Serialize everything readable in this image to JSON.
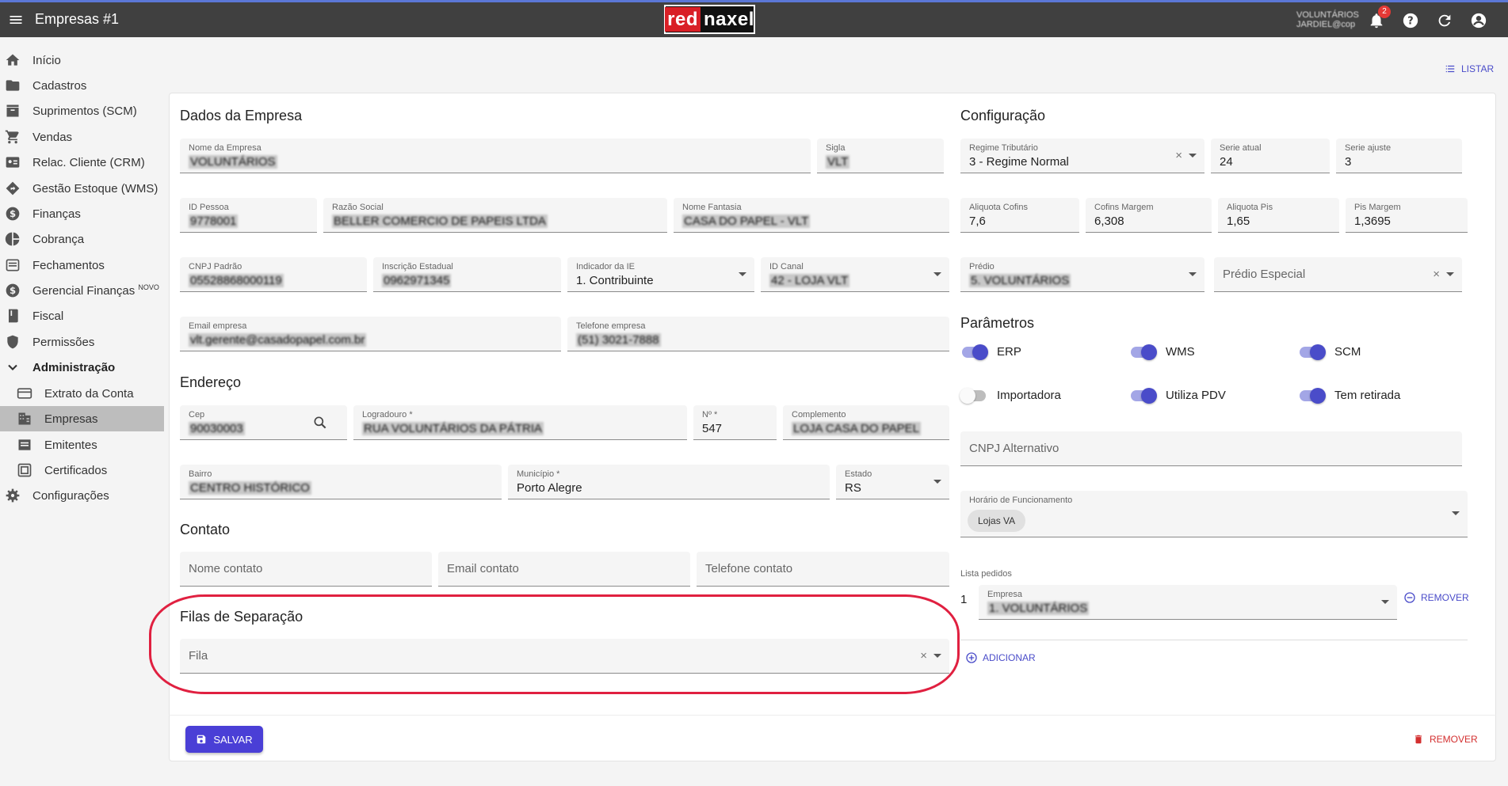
{
  "header": {
    "title": "Empresas #1",
    "logo_left": "red",
    "logo_right": "naxel",
    "user_line1": "VOLUNTÁRIOS",
    "user_line2": "JARDIEL@cop",
    "notifications": "2"
  },
  "sidebar": {
    "items": [
      {
        "label": "Início"
      },
      {
        "label": "Cadastros"
      },
      {
        "label": "Suprimentos (SCM)"
      },
      {
        "label": "Vendas"
      },
      {
        "label": "Relac. Cliente (CRM)"
      },
      {
        "label": "Gestão Estoque (WMS)"
      },
      {
        "label": "Finanças"
      },
      {
        "label": "Cobrança"
      },
      {
        "label": "Fechamentos"
      },
      {
        "label": "Gerencial Finanças",
        "badge": "NOVO"
      },
      {
        "label": "Fiscal"
      },
      {
        "label": "Permissões"
      },
      {
        "label": "Administração"
      },
      {
        "label": "Extrato da Conta"
      },
      {
        "label": "Empresas"
      },
      {
        "label": "Emitentes"
      },
      {
        "label": "Certificados"
      },
      {
        "label": "Configurações"
      }
    ]
  },
  "listar_label": "LISTAR",
  "dados": {
    "title": "Dados da Empresa",
    "nome_empresa": {
      "label": "Nome da Empresa",
      "value": "VOLUNTÁRIOS"
    },
    "sigla": {
      "label": "Sigla",
      "value": "VLT"
    },
    "id_pessoa": {
      "label": "ID Pessoa",
      "value": "9778001"
    },
    "razao_social": {
      "label": "Razão Social",
      "value": "BELLER COMERCIO DE PAPEIS LTDA"
    },
    "nome_fantasia": {
      "label": "Nome Fantasia",
      "value": "CASA DO PAPEL - VLT"
    },
    "cnpj": {
      "label": "CNPJ Padrão",
      "value": "05528868000119"
    },
    "inscricao": {
      "label": "Inscrição Estadual",
      "value": "0962971345"
    },
    "indicador_ie": {
      "label": "Indicador da IE",
      "value": "1. Contribuinte"
    },
    "id_canal": {
      "label": "ID Canal",
      "value": "42 - LOJA VLT"
    },
    "email": {
      "label": "Email empresa",
      "value": "vlt.gerente@casadopapel.com.br"
    },
    "telefone": {
      "label": "Telefone empresa",
      "value": "(51) 3021-7888"
    }
  },
  "endereco": {
    "title": "Endereço",
    "cep": {
      "label": "Cep",
      "value": "90030003"
    },
    "logradouro": {
      "label": "Logradouro *",
      "value": "RUA VOLUNTÁRIOS DA PÁTRIA"
    },
    "numero": {
      "label": "Nº *",
      "value": "547"
    },
    "complemento": {
      "label": "Complemento",
      "value": "LOJA CASA DO PAPEL"
    },
    "bairro": {
      "label": "Bairro",
      "value": "CENTRO HISTÓRICO"
    },
    "municipio": {
      "label": "Município *",
      "value": "Porto Alegre"
    },
    "estado": {
      "label": "Estado",
      "value": "RS"
    }
  },
  "contato": {
    "title": "Contato",
    "nome_placeholder": "Nome contato",
    "email_placeholder": "Email contato",
    "telefone_placeholder": "Telefone contato"
  },
  "filas": {
    "title": "Filas de Separação",
    "fila_placeholder": "Fila"
  },
  "config": {
    "title": "Configuração",
    "regime": {
      "label": "Regime Tributário",
      "value": "3 - Regime Normal"
    },
    "serie_atual": {
      "label": "Serie atual",
      "value": "24"
    },
    "serie_ajuste": {
      "label": "Serie ajuste",
      "value": "3"
    },
    "aliquota_cofins": {
      "label": "Aliquota Cofins",
      "value": "7,6"
    },
    "cofins_margem": {
      "label": "Cofins Margem",
      "value": "6,308"
    },
    "aliquota_pis": {
      "label": "Aliquota Pis",
      "value": "1,65"
    },
    "pis_margem": {
      "label": "Pis Margem",
      "value": "1,3695"
    },
    "predio": {
      "label": "Prédio",
      "value": "5. VOLUNTÁRIOS"
    },
    "predio_especial_placeholder": "Prédio Especial"
  },
  "parametros": {
    "title": "Parâmetros",
    "toggles": [
      {
        "label": "ERP",
        "on": true
      },
      {
        "label": "WMS",
        "on": true
      },
      {
        "label": "SCM",
        "on": true
      },
      {
        "label": "Importadora",
        "on": false
      },
      {
        "label": "Utiliza PDV",
        "on": true
      },
      {
        "label": "Tem retirada",
        "on": true
      }
    ],
    "cnpj_alt_placeholder": "CNPJ Alternativo",
    "horario": {
      "label": "Horário de Funcionamento",
      "chip": "Lojas VA"
    },
    "lista_pedidos_label": "Lista pedidos",
    "pedido_index": "1",
    "pedido_empresa": {
      "label": "Empresa",
      "value": "1. VOLUNTÁRIOS"
    },
    "remover_label": "REMOVER",
    "adicionar_label": "ADICIONAR"
  },
  "footer": {
    "save_label": "SALVAR",
    "remove_label": "REMOVER"
  },
  "colors": {
    "accent": "#4a3fd6",
    "highlight": "#e02040",
    "topbar": "#404040"
  }
}
